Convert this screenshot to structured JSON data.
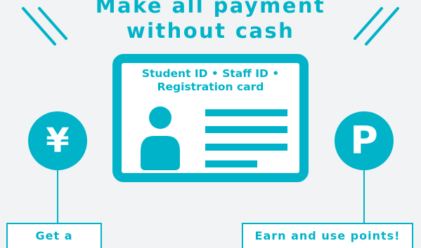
{
  "headline": {
    "line1": "Make all payment",
    "line2": "without cash"
  },
  "card": {
    "title_line1": "Student ID • Staff ID •",
    "title_line2": "Registration card",
    "icons": [
      "person-silhouette-icon",
      "text-lines-icon"
    ]
  },
  "left_badge": {
    "icon": "yen-icon",
    "symbol": "¥",
    "label": "Get a discount!"
  },
  "right_badge": {
    "icon": "points-icon",
    "symbol": "P",
    "label": "Earn and use points!"
  },
  "colors": {
    "accent": "#00b3c9",
    "background": "#f1f3f4",
    "card_fill": "#ffffff"
  }
}
